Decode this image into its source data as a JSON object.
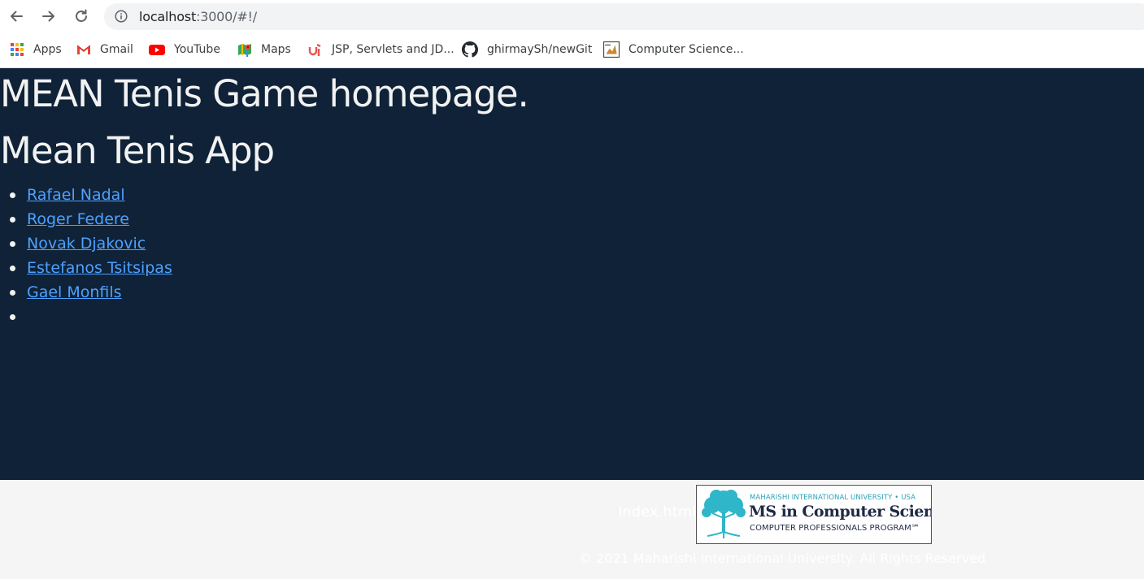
{
  "browser": {
    "url_host": "localhost",
    "url_path": ":3000/#!/",
    "bookmarks": [
      {
        "label": "Apps",
        "icon": "apps-grid-icon"
      },
      {
        "label": "Gmail",
        "icon": "gmail-icon"
      },
      {
        "label": "YouTube",
        "icon": "youtube-icon"
      },
      {
        "label": "Maps",
        "icon": "maps-icon"
      },
      {
        "label": "JSP, Servlets and JD...",
        "icon": "udemy-icon"
      },
      {
        "label": "ghirmaySh/newGit",
        "icon": "github-icon"
      },
      {
        "label": "Computer Science...",
        "icon": "computer-science-icon"
      }
    ]
  },
  "page": {
    "heading": "MEAN Tenis Game homepage.",
    "app_title": "Mean Tenis App",
    "players": [
      {
        "name": "Rafael Nadal"
      },
      {
        "name": "Roger Federe"
      },
      {
        "name": "Novak Djakovic"
      },
      {
        "name": "Estefanos Tsitsipas"
      },
      {
        "name": "Gael Monfils"
      },
      {
        "name": ""
      }
    ]
  },
  "footer": {
    "index_link": "Index.html",
    "copyright": "© 2021 Maharishi International University. All Rights Reserved",
    "logo": {
      "line1": "MAHARISHI INTERNATIONAL UNIVERSITY • USA",
      "line2": "MS in Computer Science",
      "line3": "COMPUTER PROFESSIONALS PROGRAM℠"
    }
  },
  "colors": {
    "page_background": "#0f2237",
    "link": "#4ea1ff",
    "footer_background": "#f5f5f5"
  }
}
